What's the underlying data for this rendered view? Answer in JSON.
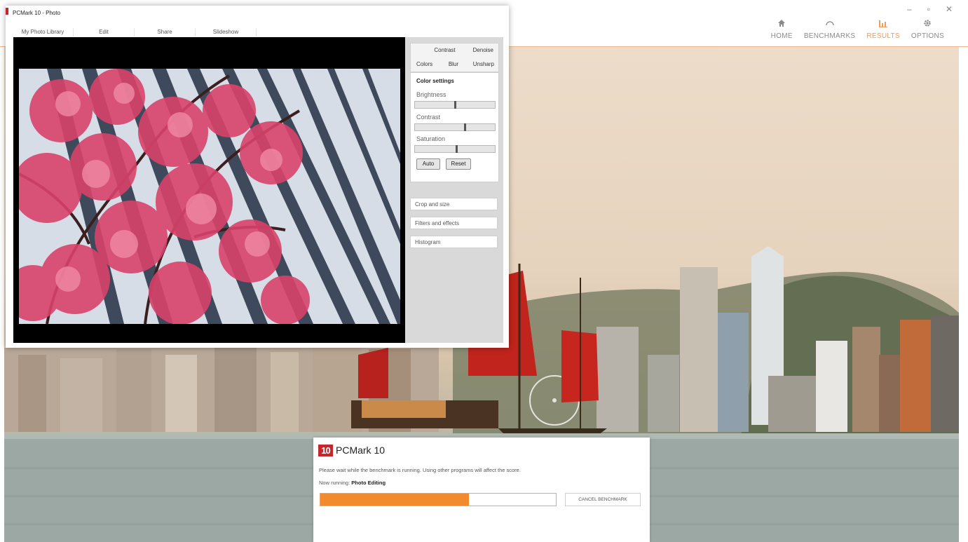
{
  "main": {
    "nav": [
      {
        "label": "HOME",
        "icon": "home-icon"
      },
      {
        "label": "BENCHMARKS",
        "icon": "gauge-icon"
      },
      {
        "label": "RESULTS",
        "icon": "bar-chart-icon",
        "active": true
      },
      {
        "label": "OPTIONS",
        "icon": "gear-icon"
      }
    ],
    "window_controls": {
      "minimize": "–",
      "maximize": "▫",
      "close": "✕"
    },
    "accent_color": "#f39a55"
  },
  "photo_app": {
    "title": "PCMark 10 - Photo",
    "tabs": [
      "My Photo Library",
      "Edit",
      "Share",
      "Slideshow"
    ],
    "edit_tabs_row1": [
      "Contrast",
      "Denoise"
    ],
    "edit_tabs_row2": [
      "Colors",
      "Blur",
      "Unsharp"
    ],
    "color_settings": {
      "title": "Color settings",
      "brightness_label": "Brightness",
      "contrast_label": "Contrast",
      "saturation_label": "Saturation",
      "brightness_value": 0.5,
      "contrast_value": 0.62,
      "saturation_value": 0.52,
      "auto_label": "Auto",
      "reset_label": "Reset"
    },
    "panels": [
      "Crop and size",
      "Filters and effects",
      "Histogram"
    ]
  },
  "benchmark": {
    "logo_text": "10",
    "app_name": "PCMark 10",
    "message": "Please wait while the benchmark is running. Using other programs will affect the score.",
    "now_running_label": "Now running:",
    "now_running_value": "Photo Editing",
    "progress": 0.63,
    "progress_color": "#f28a2e",
    "cancel_label": "CANCEL BENCHMARK"
  }
}
